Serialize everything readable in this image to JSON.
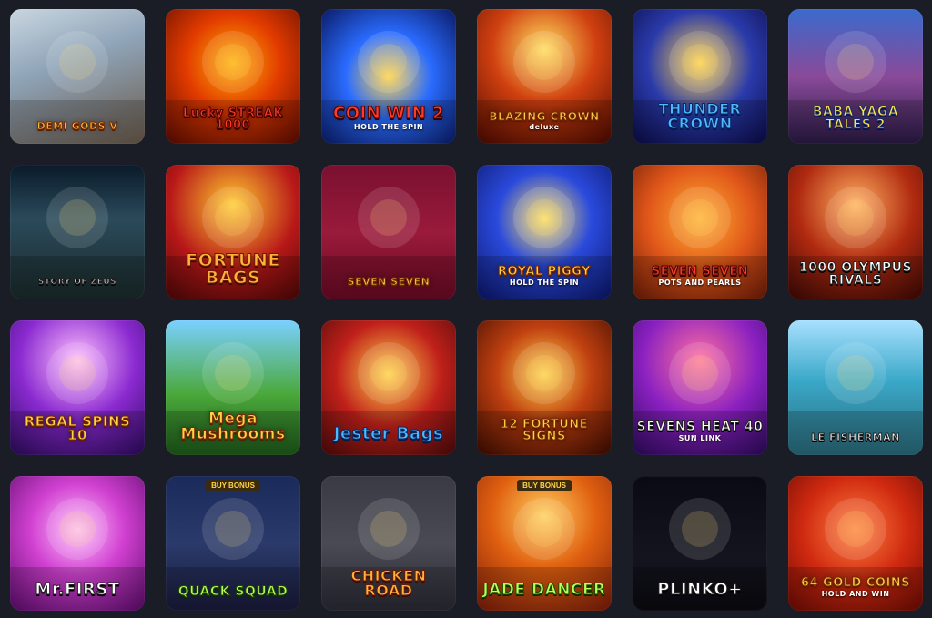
{
  "tiles": [
    {
      "id": "demi-gods",
      "name": "DEMI GODS V",
      "sub": "",
      "badge": "",
      "style": "t-gold",
      "fs": 11,
      "bg": "linear-gradient(160deg,#c9d6e0 0%,#8fa4b8 40%,#6a5a4a 100%)"
    },
    {
      "id": "lucky-streak",
      "name": "Lucky STREAK 1000",
      "sub": "",
      "badge": "",
      "style": "t-red",
      "fs": 13,
      "bg": "radial-gradient(circle at 50% 40%,#ffb000 0%,#e23b00 45%,#5a0a00 100%)"
    },
    {
      "id": "coin-win-2",
      "name": "COIN WIN 2",
      "sub": "HOLD THE SPIN",
      "badge": "",
      "style": "t-red",
      "fs": 18,
      "bg": "radial-gradient(circle at 50% 50%,#ffd34a 0%,#2a6cff 45%,#0a1a66 100%)"
    },
    {
      "id": "blazing-crown",
      "name": "BLAZING CROWN",
      "sub": "deluxe",
      "badge": "",
      "style": "t-gold",
      "fs": 12,
      "bg": "radial-gradient(circle at 50% 30%,#ffdf60 0%,#d04010 45%,#4a0800 100%)"
    },
    {
      "id": "thunder-crown",
      "name": "THUNDER CROWN",
      "sub": "",
      "badge": "",
      "style": "t-blue",
      "fs": 16,
      "bg": "radial-gradient(circle at 50% 40%,#ffd34a 0%,#2a3aaa 50%,#0a0a44 100%)"
    },
    {
      "id": "baba-yaga",
      "name": "BABA YAGA TALES 2",
      "sub": "",
      "badge": "",
      "style": "t-yellow",
      "fs": 14,
      "bg": "linear-gradient(180deg,#3a6acc 0%,#8a4a9a 50%,#2a1a44 100%)"
    },
    {
      "id": "story-of-zeus",
      "name": "STORY OF ZEUS",
      "sub": "",
      "badge": "",
      "style": "t-white",
      "fs": 9,
      "bg": "linear-gradient(180deg,#0a1a2a 0%,#2a4a5a 40%,#1a2a2a 100%)"
    },
    {
      "id": "fortune-bags",
      "name": "FORTUNE BAGS",
      "sub": "",
      "badge": "",
      "style": "t-orange",
      "fs": 19,
      "bg": "radial-gradient(circle at 50% 30%,#ffcc30 0%,#b81818 55%,#4a0606 100%)"
    },
    {
      "id": "seven-seven",
      "name": "SEVEN SEVEN",
      "sub": "",
      "badge": "",
      "style": "t-gold",
      "fs": 11,
      "bg": "linear-gradient(180deg,#7a1030 0%,#9a1a3a 50%,#6a0a24 100%)"
    },
    {
      "id": "royal-piggy",
      "name": "ROYAL PIGGY",
      "sub": "HOLD THE SPIN",
      "badge": "",
      "style": "t-gold",
      "fs": 13,
      "bg": "radial-gradient(circle at 50% 40%,#ffe060 0%,#2a4adc 45%,#0a1466 100%)"
    },
    {
      "id": "seven-seven-pots",
      "name": "SEVEN SEVEN",
      "sub": "POTS AND PEARLS",
      "badge": "",
      "style": "t-red",
      "fs": 13,
      "bg": "radial-gradient(circle at 50% 40%,#ffb030 0%,#e0561a 50%,#6a1a06 100%)"
    },
    {
      "id": "olympus-rivals",
      "name": "1000 OLYMPUS RIVALS",
      "sub": "",
      "badge": "",
      "style": "t-white",
      "fs": 14,
      "bg": "radial-gradient(circle at 50% 30%,#ffb060 0%,#b02a10 50%,#3a0804 100%)"
    },
    {
      "id": "regal-spins",
      "name": "REGAL SPINS 10",
      "sub": "",
      "badge": "",
      "style": "t-gold",
      "fs": 15,
      "bg": "radial-gradient(circle at 50% 30%,#ffc0ff 0%,#8a2ad0 50%,#2a0a5a 100%)"
    },
    {
      "id": "mega-mushrooms",
      "name": "Mega Mushrooms",
      "sub": "",
      "badge": "",
      "style": "t-gold",
      "fs": 17,
      "bg": "linear-gradient(180deg,#7ad0ff 0%,#4aa83a 55%,#1e5a1a 100%)"
    },
    {
      "id": "jester-bags",
      "name": "Jester Bags",
      "sub": "",
      "badge": "",
      "style": "t-blue",
      "fs": 18,
      "bg": "radial-gradient(circle at 50% 40%,#ffd34a 0%,#c0201a 50%,#4a0a0a 100%)"
    },
    {
      "id": "fortune-signs",
      "name": "12 FORTUNE SIGNS",
      "sub": "",
      "badge": "",
      "style": "t-gold",
      "fs": 13,
      "bg": "radial-gradient(circle at 50% 40%,#ffd34a 0%,#c04010 45%,#3a0a00 100%)"
    },
    {
      "id": "sevens-heat",
      "name": "SEVENS HEAT 40",
      "sub": "SUN LINK",
      "badge": "",
      "style": "t-white",
      "fs": 14,
      "bg": "radial-gradient(circle at 50% 30%,#ff70a0 0%,#8a20c0 50%,#2a0a5a 100%)"
    },
    {
      "id": "le-fisherman",
      "name": "LE FISHERMAN",
      "sub": "",
      "badge": "",
      "style": "t-white",
      "fs": 11,
      "bg": "linear-gradient(180deg,#a8e0ff 0%,#3aa8c8 45%,#2a6a7a 100%)"
    },
    {
      "id": "mr-first",
      "name": "Mr.FIRST",
      "sub": "",
      "badge": "",
      "style": "t-white",
      "fs": 18,
      "bg": "radial-gradient(circle at 50% 40%,#ffc0ff 0%,#d040d0 45%,#5a0a6a 100%)"
    },
    {
      "id": "quack-squad",
      "name": "QUACK SQUAD",
      "sub": "",
      "badge": "BUY BONUS",
      "style": "t-green",
      "fs": 14,
      "bg": "linear-gradient(180deg,#1a2a5a 0%,#2a3a6a 50%,#1a1a3a 100%)"
    },
    {
      "id": "chicken-road",
      "name": "CHICKEN ROAD",
      "sub": "",
      "badge": "",
      "style": "t-orange",
      "fs": 16,
      "bg": "linear-gradient(180deg,#3a3a44 0%,#4a4a54 50%,#2a2a34 100%)"
    },
    {
      "id": "jade-dancer",
      "name": "JADE DANCER",
      "sub": "",
      "badge": "BUY BONUS",
      "style": "t-green",
      "fs": 17,
      "bg": "radial-gradient(circle at 50% 30%,#ffd060 0%,#e06010 45%,#7a1a0a 100%)"
    },
    {
      "id": "plinko",
      "name": "PLINKO+",
      "sub": "",
      "badge": "",
      "style": "t-white",
      "fs": 18,
      "bg": "linear-gradient(180deg,#0a0a14 0%,#14141e 60%,#0a0a10 100%)"
    },
    {
      "id": "gold-coins",
      "name": "64 GOLD COINS",
      "sub": "HOLD AND WIN",
      "badge": "",
      "style": "t-gold",
      "fs": 13,
      "bg": "radial-gradient(circle at 50% 40%,#ff8040 0%,#d02a10 50%,#6a0a04 100%)"
    }
  ]
}
